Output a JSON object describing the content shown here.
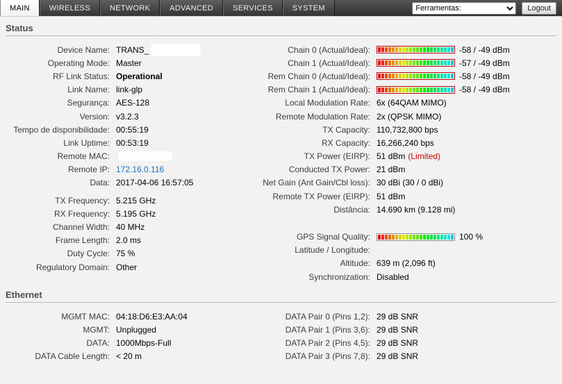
{
  "nav": {
    "tabs": [
      {
        "id": "main",
        "label": "MAIN",
        "active": true
      },
      {
        "id": "wireless",
        "label": "WIRELESS",
        "active": false
      },
      {
        "id": "network",
        "label": "NETWORK",
        "active": false
      },
      {
        "id": "advanced",
        "label": "ADVANCED",
        "active": false
      },
      {
        "id": "services",
        "label": "SERVICES",
        "active": false
      },
      {
        "id": "system",
        "label": "SYSTEM",
        "active": false
      }
    ],
    "tools_dropdown": {
      "selected": "Ferramentas:"
    },
    "logout_label": "Logout"
  },
  "colors": {
    "link_blue": "#2471b8",
    "limited_red": "#cc0000",
    "chain_bar_border": "#b40000",
    "gps_bar_border": "#8f8f8f"
  },
  "status": {
    "title": "Status",
    "left_rows": [
      {
        "label": "Device Name:",
        "value": "TRANS_",
        "redact_w": 72,
        "redact_h": 18
      },
      {
        "label": "Operating Mode:",
        "value": "Master"
      },
      {
        "label": "RF Link Status:",
        "value": "Operational",
        "bold": true
      },
      {
        "label": "Link Name:",
        "value": "link-glp"
      },
      {
        "label": "Segurança:",
        "value": "AES-128"
      },
      {
        "label": "Version:",
        "value": "v3.2.3"
      },
      {
        "label": "Tempo de disponibilidade:",
        "value": "00:55:19"
      },
      {
        "label": "Link Uptime:",
        "value": "00:53:19"
      },
      {
        "label": "Remote MAC:",
        "value": "",
        "redact_w": 78,
        "redact_h": 14
      },
      {
        "label": "Remote IP:",
        "value": "172.16.0.116",
        "link": true
      },
      {
        "label": "Data:",
        "value": "2017-04-06 16:57:05"
      },
      {
        "spacer": 6
      },
      {
        "label": "TX Frequency:",
        "value": "5.215 GHz"
      },
      {
        "label": "RX Frequency:",
        "value": "5.195 GHz"
      },
      {
        "label": "Channel Width:",
        "value": "40 MHz"
      },
      {
        "label": "Frame Length:",
        "value": "2.0 ms"
      },
      {
        "label": "Duty Cycle:",
        "value": "75 %"
      },
      {
        "label": "Regulatory Domain:",
        "value": "Other"
      }
    ],
    "right_rows": [
      {
        "label": "Chain 0 (Actual/Ideal):",
        "bar": {
          "name": "chain0-signal-bar",
          "fill_percent": 100,
          "border": "#b40000"
        },
        "value": "-58 / -49 dBm"
      },
      {
        "label": "Chain 1 (Actual/Ideal):",
        "bar": {
          "name": "chain1-signal-bar",
          "fill_percent": 100,
          "border": "#b40000"
        },
        "value": "-57 / -49 dBm"
      },
      {
        "label": "Rem Chain 0 (Actual/Ideal):",
        "bar": {
          "name": "rem-chain0-signal-bar",
          "fill_percent": 100,
          "border": "#b40000"
        },
        "value": "-58 / -49 dBm"
      },
      {
        "label": "Rem Chain 1 (Actual/Ideal):",
        "bar": {
          "name": "rem-chain1-signal-bar",
          "fill_percent": 100,
          "border": "#b40000"
        },
        "value": "-58 / -49 dBm"
      },
      {
        "label": "Local Modulation Rate:",
        "value": "6x (64QAM MIMO)"
      },
      {
        "label": "Remote Modulation Rate:",
        "value": "2x (QPSK MIMO)"
      },
      {
        "label": "TX Capacity:",
        "value": "110,732,800 bps"
      },
      {
        "label": "RX Capacity:",
        "value": "16,266,240 bps"
      },
      {
        "label": "TX Power (EIRP):",
        "value": "51 dBm",
        "suffix": " (Limited)"
      },
      {
        "label": "Conducted TX Power:",
        "value": "21 dBm"
      },
      {
        "label": "Net Gain (Ant Gain/Cbl loss):",
        "value": "30 dBi (30 / 0 dBi)"
      },
      {
        "label": "Remote TX Power (EIRP):",
        "value": "51 dBm"
      },
      {
        "label": "Distância:",
        "value": "14.690 km (9.128 mi)"
      },
      {
        "spacer": 20
      },
      {
        "label": "GPS Signal Quality:",
        "bar": {
          "name": "gps-signal-bar",
          "fill_percent": 100,
          "border": "#8f8f8f"
        },
        "value": "100 %"
      },
      {
        "label": "Latitude / Longitude:",
        "value": ""
      },
      {
        "label": "Altitude:",
        "value": "639 m (2,096 ft)"
      },
      {
        "label": "Synchronization:",
        "value": "Disabled"
      }
    ]
  },
  "ethernet": {
    "title": "Ethernet",
    "left_rows": [
      {
        "label": "MGMT MAC:",
        "value": "04:18:D6:E3:AA:04"
      },
      {
        "label": "MGMT:",
        "value": "Unplugged"
      },
      {
        "label": "DATA:",
        "value": "1000Mbps-Full"
      },
      {
        "label": "DATA Cable Length:",
        "value": "< 20 m"
      }
    ],
    "right_rows": [
      {
        "label": "DATA Pair 0 (Pins 1,2):",
        "value": "29 dB SNR"
      },
      {
        "label": "DATA Pair 1 (Pins 3,6):",
        "value": "29 dB SNR"
      },
      {
        "label": "DATA Pair 2 (Pins 4,5):",
        "value": "29 dB SNR"
      },
      {
        "label": "DATA Pair 3 (Pins 7,8):",
        "value": "29 dB SNR"
      }
    ]
  }
}
